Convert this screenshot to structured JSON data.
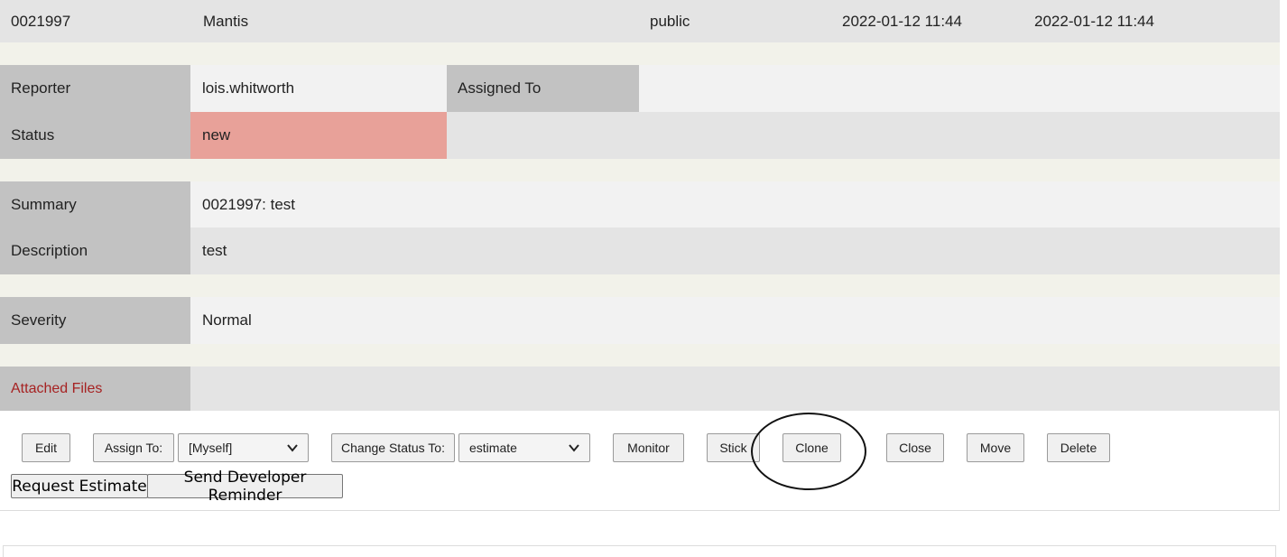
{
  "issue_row": {
    "id": "0021997",
    "project": "Mantis",
    "view_status": "public",
    "date_submitted": "2022-01-12 11:44",
    "last_update": "2022-01-12 11:44"
  },
  "fields": {
    "reporter_label": "Reporter",
    "reporter_value": "lois.whitworth",
    "assigned_to_label": "Assigned To",
    "assigned_to_value": "",
    "status_label": "Status",
    "status_value": "new",
    "summary_label": "Summary",
    "summary_value": "0021997: test",
    "description_label": "Description",
    "description_value": "test",
    "severity_label": "Severity",
    "severity_value": "Normal",
    "attached_files_label": "Attached Files"
  },
  "actions": {
    "edit": "Edit",
    "assign_to": "Assign To:",
    "assign_select": "[Myself]",
    "change_status": "Change Status To:",
    "status_select": "estimate",
    "monitor": "Monitor",
    "stick": "Stick",
    "clone": "Clone",
    "close": "Close",
    "move": "Move",
    "delete": "Delete",
    "request_estimate": "Request Estimate",
    "send_reminder": "Send Developer Reminder"
  },
  "colors": {
    "status_new": "#e8a199",
    "label_bg": "#c2c2c2",
    "attached_label": "#a62222",
    "highlight_circle": "#111111"
  },
  "icons": {
    "select_chevron": "chevron-down-icon"
  }
}
